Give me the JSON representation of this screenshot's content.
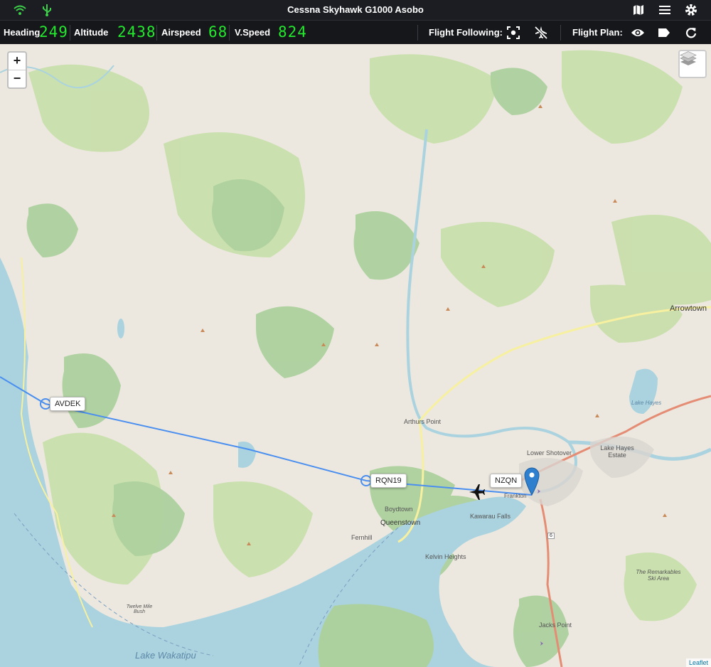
{
  "titlebar": {
    "title": "Cessna Skyhawk G1000 Asobo",
    "icons": [
      "wifi-icon",
      "usb-icon",
      "map-icon",
      "menu-icon",
      "settings-icon"
    ]
  },
  "statusbar": {
    "heading_label": "Heading",
    "heading_value": "249",
    "altitude_label": "Altitude",
    "altitude_value": "2438",
    "airspeed_label": "Airspeed",
    "airspeed_value": "68",
    "vspeed_label": "V.Speed",
    "vspeed_value": "824",
    "flight_following_label": "Flight Following:",
    "flight_plan_label": "Flight Plan:",
    "value_color": "#24e82e"
  },
  "map": {
    "zoom_in": "+",
    "zoom_out": "−",
    "waypoints": [
      {
        "id": "AVDEK",
        "label": "AVDEK"
      },
      {
        "id": "RQN19",
        "label": "RQN19"
      },
      {
        "id": "NZQN",
        "label": "NZQN"
      }
    ],
    "places": {
      "arrowtown": "Arrowtown",
      "arthurs_point": "Arthurs Point",
      "lower_shotover": "Lower Shotover",
      "lake_hayes_estate": "Lake Hayes Estate",
      "lake_hayes": "Lake Hayes",
      "boydtown": "Boydtown",
      "queenstown": "Queenstown",
      "kawarau_falls": "Kawarau Falls",
      "frankton": "Frankton",
      "fernhill": "Fernhill",
      "kelvin_heights": "Kelvin Heights",
      "jacks_point": "Jacks Point",
      "remarkables": "The Remarkables Ski Area",
      "twelve_mile_bush": "Twelve Mile Bush",
      "lake_wakatipu": "Lake Wakatipu"
    },
    "road_number": "6",
    "attribution": "Leaflet",
    "route_color": "#4a8ff0",
    "water_color": "#aad3df",
    "forest_color": "#add19e"
  }
}
